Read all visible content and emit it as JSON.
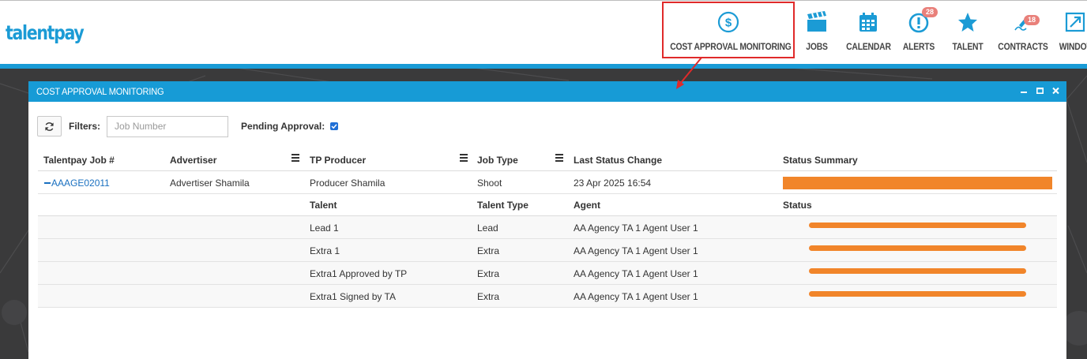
{
  "app": {
    "logo": "talentpay"
  },
  "nav": {
    "items": [
      {
        "key": "cost",
        "label": "COST APPROVAL MONITORING",
        "icon": "dollar-circle-icon",
        "badge": ""
      },
      {
        "key": "jobs",
        "label": "JOBS",
        "icon": "clapperboard-icon",
        "badge": ""
      },
      {
        "key": "calendar",
        "label": "CALENDAR",
        "icon": "calendar-icon",
        "badge": ""
      },
      {
        "key": "alerts",
        "label": "ALERTS",
        "icon": "alert-icon",
        "badge": "28"
      },
      {
        "key": "talent",
        "label": "TALENT",
        "icon": "star-icon",
        "badge": ""
      },
      {
        "key": "contracts",
        "label": "CONTRACTS",
        "icon": "contract-pen-icon",
        "badge": "18"
      },
      {
        "key": "window",
        "label": "WINDOW",
        "icon": "expand-window-icon",
        "badge": ""
      }
    ]
  },
  "dialog": {
    "title": "COST APPROVAL MONITORING",
    "filters_label": "Filters:",
    "job_number_placeholder": "Job Number",
    "pending_approval_label": "Pending Approval:",
    "pending_approval_checked": true
  },
  "grid": {
    "columns": [
      "Talentpay Job #",
      "Advertiser",
      "TP Producer",
      "Job Type",
      "Last Status Change",
      "Status Summary"
    ],
    "rows": [
      {
        "job": "AAAGE02011",
        "advertiser": "Advertiser Shamila",
        "producer": "Producer Shamila",
        "job_type": "Shoot",
        "last_change": "23 Apr 2025 16:54",
        "status_summary_progress": 1.0
      }
    ],
    "sub_columns": [
      "Talent",
      "Talent Type",
      "Agent",
      "Status"
    ],
    "sub_rows": [
      {
        "talent": "Lead 1",
        "type": "Lead",
        "agent": "AA Agency TA 1 Agent User 1",
        "status_progress": 1.0
      },
      {
        "talent": "Extra 1",
        "type": "Extra",
        "agent": "AA Agency TA 1 Agent User 1",
        "status_progress": 1.0
      },
      {
        "talent": "Extra1 Approved by TP",
        "type": "Extra",
        "agent": "AA Agency TA 1 Agent User 1",
        "status_progress": 1.0
      },
      {
        "talent": "Extra1 Signed by TA",
        "type": "Extra",
        "agent": "AA Agency TA 1 Agent User 1",
        "status_progress": 1.0
      }
    ]
  },
  "colors": {
    "brand": "#1b9bd5",
    "status": "#f1852a",
    "badge": "#e9807a",
    "highlight": "#e02a2a"
  }
}
